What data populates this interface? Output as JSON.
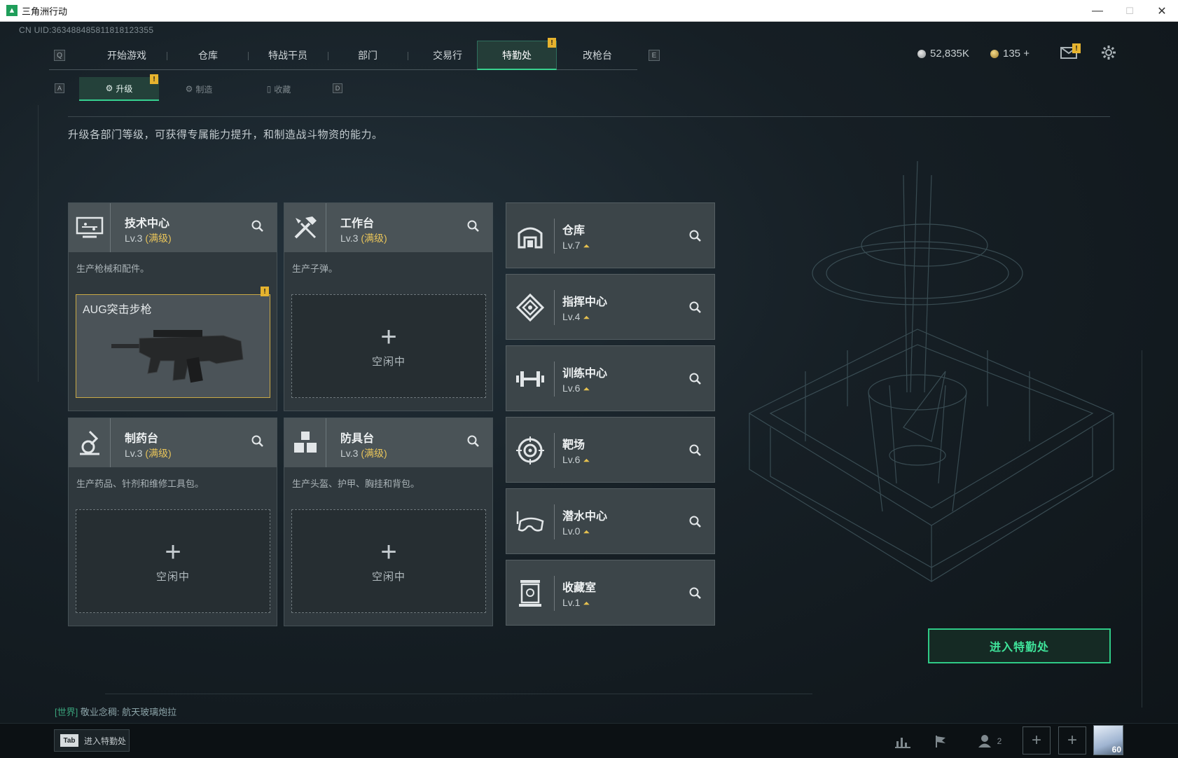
{
  "window": {
    "title": "三角洲行动",
    "logo_glyph": "▲",
    "minimize": "—",
    "maximize": "☐",
    "close": "✕"
  },
  "uid": "CN UID:363488485811818123355",
  "nav": {
    "key_left": "Q",
    "key_right": "E",
    "tabs": [
      "开始游戏",
      "仓库",
      "特战干员",
      "部门",
      "交易行",
      "特勤处",
      "改枪台"
    ],
    "active": "特勤处"
  },
  "badge_glyph": "!",
  "currencies": {
    "silver": "52,835K",
    "gold": "135 +"
  },
  "subnav": {
    "key_left": "A",
    "key_right": "D",
    "tabs": [
      {
        "label": "升级",
        "icon": "⚙"
      },
      {
        "label": "制造",
        "icon": "⚙"
      },
      {
        "label": "收藏",
        "icon": "▯"
      }
    ],
    "active": "升级"
  },
  "description": "升级各部门等级，可获得专属能力提升，和制造战斗物资的能力。",
  "slot": {
    "plus": "+",
    "idle": "空闲中"
  },
  "production_cards": [
    {
      "name": "技术中心",
      "level": "Lv.3",
      "status": "(满级)",
      "desc": "生产枪械和配件。",
      "icon": "tech-center-icon",
      "item": "AUG突击步枪"
    },
    {
      "name": "工作台",
      "level": "Lv.3",
      "status": "(满级)",
      "desc": "生产子弹。",
      "icon": "workbench-icon"
    },
    {
      "name": "制药台",
      "level": "Lv.3",
      "status": "(满级)",
      "desc": "生产药品、针剂和维修工具包。",
      "icon": "pharmacy-icon"
    },
    {
      "name": "防具台",
      "level": "Lv.3",
      "status": "(满级)",
      "desc": "生产头盔、护甲、胸挂和背包。",
      "icon": "armor-bench-icon"
    }
  ],
  "facilities": [
    {
      "name": "仓库",
      "level": "Lv.7",
      "icon": "warehouse-icon"
    },
    {
      "name": "指挥中心",
      "level": "Lv.4",
      "icon": "command-center-icon"
    },
    {
      "name": "训练中心",
      "level": "Lv.6",
      "icon": "training-center-icon"
    },
    {
      "name": "靶场",
      "level": "Lv.6",
      "icon": "shooting-range-icon"
    },
    {
      "name": "潜水中心",
      "level": "Lv.0",
      "icon": "diving-center-icon"
    },
    {
      "name": "收藏室",
      "level": "Lv.1",
      "icon": "collection-room-icon"
    }
  ],
  "enter_button": "进入特勤处",
  "chat": {
    "channel": "[世界]",
    "message": "敬业念稠: 航天玻璃炮拉"
  },
  "bottom": {
    "tab_key": "Tab",
    "tab_label": "进入特勤处",
    "friends_count": "2",
    "player_level": "60"
  }
}
